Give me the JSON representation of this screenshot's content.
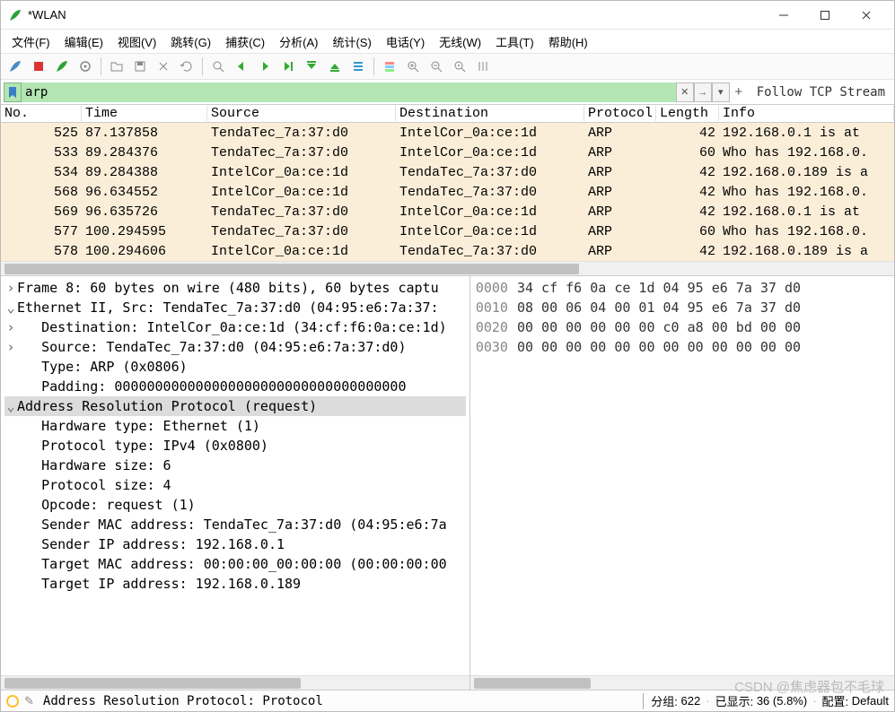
{
  "window": {
    "title": "*WLAN"
  },
  "menus": {
    "file": "文件(F)",
    "edit": "编辑(E)",
    "view": "视图(V)",
    "go": "跳转(G)",
    "capture": "捕获(C)",
    "analyze": "分析(A)",
    "statistics": "统计(S)",
    "telephony": "电话(Y)",
    "wireless": "无线(W)",
    "tools": "工具(T)",
    "help": "帮助(H)"
  },
  "filter": {
    "value": "arp",
    "follow": "Follow TCP Stream"
  },
  "columns": {
    "no": "No.",
    "time": "Time",
    "source": "Source",
    "destination": "Destination",
    "protocol": "Protocol",
    "length": "Length",
    "info": "Info"
  },
  "packets": [
    {
      "no": "525",
      "time": "87.137858",
      "src": "TendaTec_7a:37:d0",
      "dst": "IntelCor_0a:ce:1d",
      "proto": "ARP",
      "len": "42",
      "info": "192.168.0.1 is at "
    },
    {
      "no": "533",
      "time": "89.284376",
      "src": "TendaTec_7a:37:d0",
      "dst": "IntelCor_0a:ce:1d",
      "proto": "ARP",
      "len": "60",
      "info": "Who has 192.168.0."
    },
    {
      "no": "534",
      "time": "89.284388",
      "src": "IntelCor_0a:ce:1d",
      "dst": "TendaTec_7a:37:d0",
      "proto": "ARP",
      "len": "42",
      "info": "192.168.0.189 is a"
    },
    {
      "no": "568",
      "time": "96.634552",
      "src": "IntelCor_0a:ce:1d",
      "dst": "TendaTec_7a:37:d0",
      "proto": "ARP",
      "len": "42",
      "info": "Who has 192.168.0."
    },
    {
      "no": "569",
      "time": "96.635726",
      "src": "TendaTec_7a:37:d0",
      "dst": "IntelCor_0a:ce:1d",
      "proto": "ARP",
      "len": "42",
      "info": "192.168.0.1 is at "
    },
    {
      "no": "577",
      "time": "100.294595",
      "src": "TendaTec_7a:37:d0",
      "dst": "IntelCor_0a:ce:1d",
      "proto": "ARP",
      "len": "60",
      "info": "Who has 192.168.0."
    },
    {
      "no": "578",
      "time": "100.294606",
      "src": "IntelCor_0a:ce:1d",
      "dst": "TendaTec_7a:37:d0",
      "proto": "ARP",
      "len": "42",
      "info": "192.168.0.189 is a"
    }
  ],
  "tree": [
    {
      "exp": ">",
      "indent": 0,
      "text": "Frame 8: 60 bytes on wire (480 bits), 60 bytes captu"
    },
    {
      "exp": "v",
      "indent": 0,
      "text": "Ethernet II, Src: TendaTec_7a:37:d0 (04:95:e6:7a:37:"
    },
    {
      "exp": ">",
      "indent": 1,
      "text": "Destination: IntelCor_0a:ce:1d (34:cf:f6:0a:ce:1d)"
    },
    {
      "exp": ">",
      "indent": 1,
      "text": "Source: TendaTec_7a:37:d0 (04:95:e6:7a:37:d0)"
    },
    {
      "exp": "",
      "indent": 1,
      "text": "Type: ARP (0x0806)"
    },
    {
      "exp": "",
      "indent": 1,
      "text": "Padding: 000000000000000000000000000000000000"
    },
    {
      "exp": "v",
      "indent": 0,
      "text": "Address Resolution Protocol (request)",
      "sel": true
    },
    {
      "exp": "",
      "indent": 1,
      "text": "Hardware type: Ethernet (1)"
    },
    {
      "exp": "",
      "indent": 1,
      "text": "Protocol type: IPv4 (0x0800)"
    },
    {
      "exp": "",
      "indent": 1,
      "text": "Hardware size: 6"
    },
    {
      "exp": "",
      "indent": 1,
      "text": "Protocol size: 4"
    },
    {
      "exp": "",
      "indent": 1,
      "text": "Opcode: request (1)"
    },
    {
      "exp": "",
      "indent": 1,
      "text": "Sender MAC address: TendaTec_7a:37:d0 (04:95:e6:7a"
    },
    {
      "exp": "",
      "indent": 1,
      "text": "Sender IP address: 192.168.0.1"
    },
    {
      "exp": "",
      "indent": 1,
      "text": "Target MAC address: 00:00:00_00:00:00 (00:00:00:00"
    },
    {
      "exp": "",
      "indent": 1,
      "text": "Target IP address: 192.168.0.189"
    }
  ],
  "hex": [
    {
      "off": "0000",
      "bytes": "34 cf f6 0a ce 1d 04 95  e6 7a 37 d0"
    },
    {
      "off": "0010",
      "bytes": "08 00 06 04 00 01 04 95  e6 7a 37 d0"
    },
    {
      "off": "0020",
      "bytes": "00 00 00 00 00 00 c0 a8  00 bd 00 00"
    },
    {
      "off": "0030",
      "bytes": "00 00 00 00 00 00 00 00  00 00 00 00"
    }
  ],
  "status": {
    "left": "Address Resolution Protocol: Protocol",
    "packets_label": "分组:",
    "packets": "622",
    "displayed_label": "已显示:",
    "displayed": "36 (5.8%)",
    "profile_label": "配置:",
    "profile": "Default"
  },
  "watermark": "CSDN @焦虑器包不毛球"
}
